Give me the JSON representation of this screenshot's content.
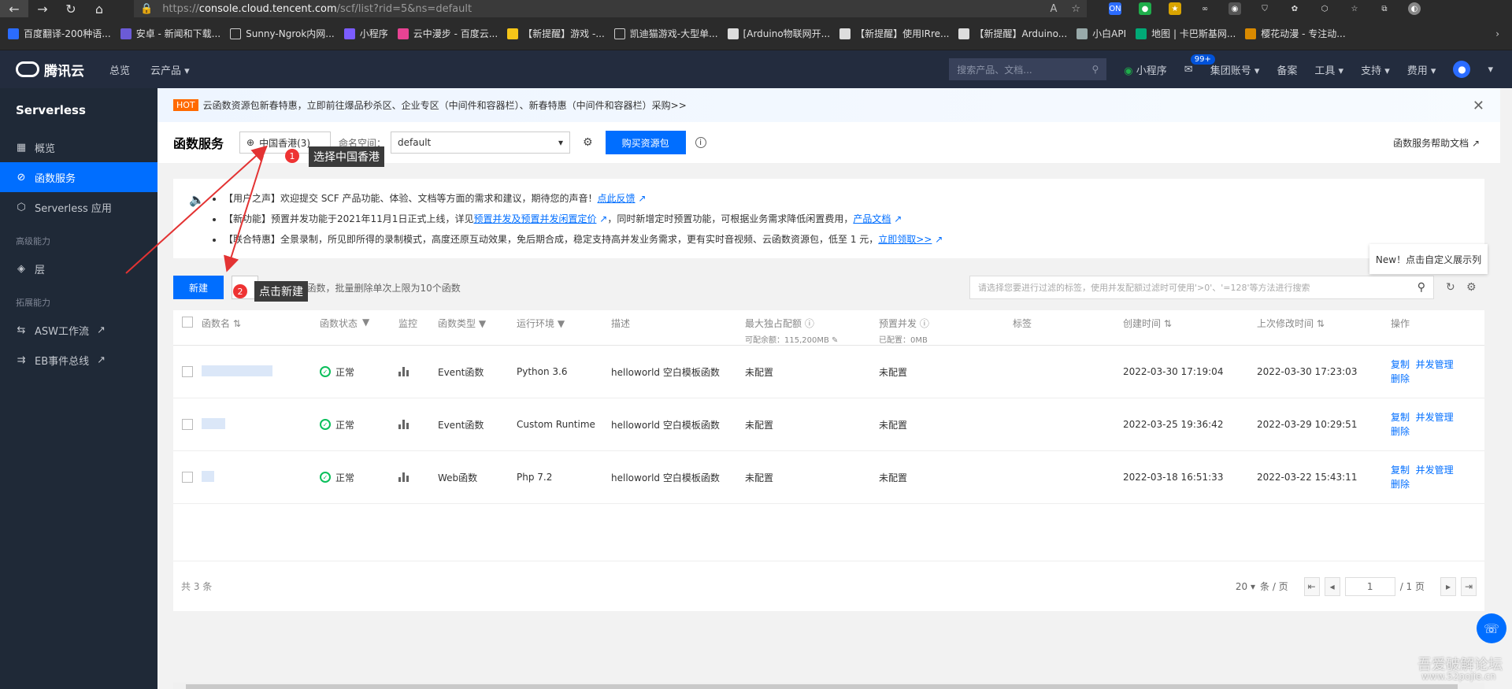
{
  "browser": {
    "url_proto": "https://",
    "url_host": "console.cloud.tencent.com",
    "url_rest": "/scf/list?rid=5&ns=default",
    "bookmarks": [
      "百度翻译-200种语...",
      "安卓 - 新闻和下载...",
      "Sunny-Ngrok内网...",
      "小程序",
      "云中漫步 - 百度云...",
      "【新提醒】游戏 -...",
      "凯迪猫游戏-大型单...",
      "[Arduino物联网开...",
      "【新提醒】使用IRre...",
      "【新提醒】Arduino...",
      "小白API",
      "地图 | 卡巴斯基网...",
      "樱花动漫 - 专注动..."
    ]
  },
  "header": {
    "brand": "腾讯云",
    "nav": [
      "总览",
      "云产品"
    ],
    "search_placeholder": "搜索产品、文档...",
    "right": [
      "小程序",
      "集团账号",
      "备案",
      "工具",
      "支持",
      "费用"
    ],
    "msg_badge": "99+"
  },
  "sidebar": {
    "title": "Serverless",
    "items": [
      {
        "label": "概览"
      },
      {
        "label": "函数服务"
      },
      {
        "label": "Serverless 应用"
      }
    ],
    "group1": "高级能力",
    "group1_items": [
      {
        "label": "层"
      }
    ],
    "group2": "拓展能力",
    "group2_items": [
      {
        "label": "ASW工作流"
      },
      {
        "label": "EB事件总线"
      }
    ]
  },
  "banner": {
    "tag": "HOT",
    "text": "云函数资源包新春特惠，立即前往爆品秒杀区、企业专区（中间件和容器栏）、新春特惠（中间件和容器栏）采购>>"
  },
  "subhead": {
    "title": "函数服务",
    "region": "中国香港(3)",
    "ns_label": "命名空间：",
    "ns_value": "default",
    "buy_label": "购买资源包",
    "help_doc": "函数服务帮助文档"
  },
  "annotations": {
    "one_num": "1",
    "one_text": "选择中国香港",
    "two_num": "2",
    "two_text": "点击新建"
  },
  "notice": {
    "items": [
      {
        "pre": "【用户之声】欢迎提交 SCF 产品功能、体验、文档等方面的需求和建议，期待您的声音！",
        "link": "点此反馈",
        "post": ""
      },
      {
        "pre": "【新功能】预置并发功能于2021年11月1日正式上线，详见",
        "link": "预置并发及预置并发闲置定价",
        "post": "，同时新增定时预置功能，可根据业务需求降低闲置费用，",
        "link2": "产品文档"
      },
      {
        "pre": "【联合特惠】全景录制，所见即所得的录制模式，高度还原互动效果，免后期合成，稳定支持高并发业务需求，更有实时音视频、云函数资源包，低至 1 元，",
        "link": "立即领取>>",
        "post": ""
      }
    ]
  },
  "toolbar": {
    "new_label": "新建",
    "hint": "已选 0个函数，批量删除单次上限为10个函数",
    "filter_placeholder": "请选择您要进行过滤的标签，使用并发配额过滤时可使用'>0'、'=128'等方法进行搜索",
    "new_tip": "New！点击自定义展示列"
  },
  "table": {
    "headers": {
      "name": "函数名",
      "status": "函数状态",
      "monitor": "监控",
      "type": "函数类型",
      "env": "运行环境",
      "desc": "描述",
      "mem": "最大独占配额",
      "mem_sub": "可配余额：115,200MB",
      "conc": "预置并发",
      "conc_sub": "已配置：0MB",
      "tag": "标签",
      "created": "创建时间",
      "modified": "上次修改时间",
      "op": "操作"
    },
    "rows": [
      {
        "status": "正常",
        "type": "Event函数",
        "env": "Python 3.6",
        "desc": "helloworld 空白模板函数",
        "mem": "未配置",
        "conc": "未配置",
        "created": "2022-03-30 17:19:04",
        "modified": "2022-03-30 17:23:03",
        "op1": "复制",
        "op2": "并发管理",
        "op3": "删除"
      },
      {
        "status": "正常",
        "type": "Event函数",
        "env": "Custom Runtime",
        "desc": "helloworld 空白模板函数",
        "mem": "未配置",
        "conc": "未配置",
        "created": "2022-03-25 19:36:42",
        "modified": "2022-03-29 10:29:51",
        "op1": "复制",
        "op2": "并发管理",
        "op3": "删除"
      },
      {
        "status": "正常",
        "type": "Web函数",
        "env": "Php 7.2",
        "desc": "helloworld 空白模板函数",
        "mem": "未配置",
        "conc": "未配置",
        "created": "2022-03-18 16:51:33",
        "modified": "2022-03-22 15:43:11",
        "op1": "复制",
        "op2": "并发管理",
        "op3": "删除"
      }
    ]
  },
  "footer": {
    "total": "共 3 条",
    "page_size": "20",
    "page_size_unit": "条 / 页",
    "page": "1",
    "page_total": "/ 1 页"
  },
  "watermark": {
    "line1": "吾爱破解论坛",
    "line2": "www.52pojie.cn"
  },
  "colors": {
    "primary": "#006eff",
    "sidebar": "#1f2937",
    "header": "#232c3e",
    "annotation": "#e33333"
  }
}
